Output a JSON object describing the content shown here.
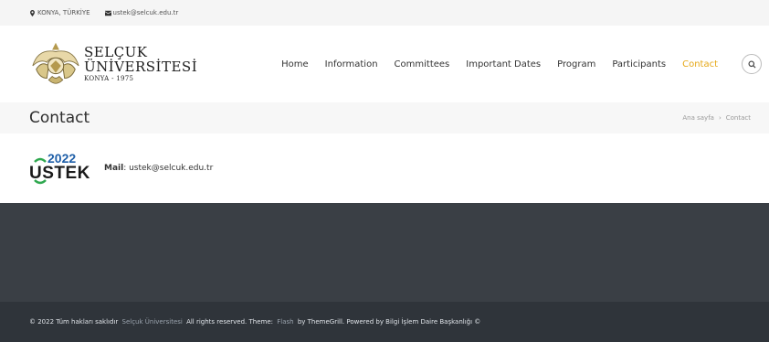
{
  "topbar": {
    "location": "KONYA, TÜRKİYE",
    "email": "ustek@selcuk.edu.tr"
  },
  "logo": {
    "line1": "SELÇUK",
    "line2": "ÜNİVERSİTESİ",
    "line3": "KONYA - 1975"
  },
  "nav": {
    "items": [
      "Home",
      "Information",
      "Committees",
      "Important Dates",
      "Program",
      "Participants",
      "Contact"
    ],
    "active": "Contact"
  },
  "pagebar": {
    "title": "Contact",
    "breadcrumb_home": "Ana sayfa",
    "breadcrumb_sep": "›",
    "breadcrumb_current": "Contact"
  },
  "content": {
    "ustek_year": "2022",
    "ustek_name": "USTEK",
    "mail_label": "Mail",
    "mail_value": ": ustek@selcuk.edu.tr"
  },
  "footer": {
    "copyright_prefix": "© 2022 Tüm hakları saklıdır",
    "university_link": "Selçuk Üniversitesi",
    "rights_text": "All rights reserved. Theme:",
    "theme_link": "Flash",
    "by_text": "by ThemeGrill. Powered by Bilgi İşlem Daire Başkanlığı ©"
  },
  "colors": {
    "accent": "#e6a817",
    "footer_bg": "#3a3f45",
    "bottombar_bg": "#2f343a"
  }
}
